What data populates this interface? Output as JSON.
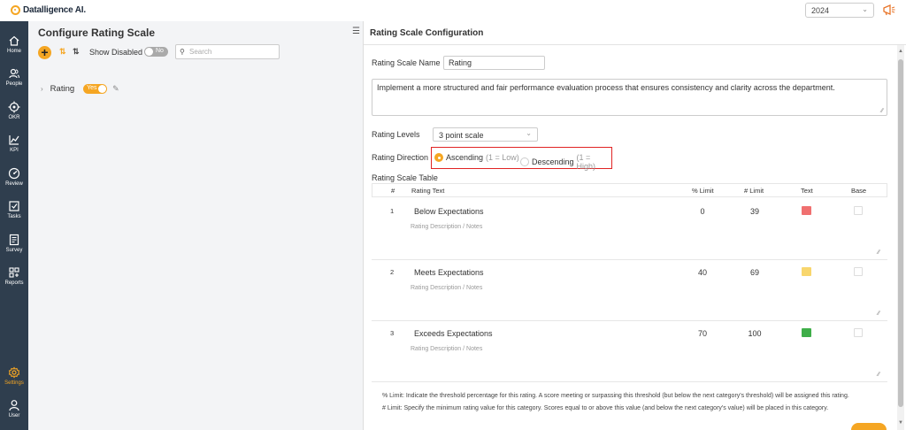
{
  "app": {
    "logo_text": "Datalligence AI."
  },
  "topbar": {
    "year_value": "2024"
  },
  "sidebar": {
    "items": [
      {
        "label": "Home",
        "icon": "home-icon"
      },
      {
        "label": "People",
        "icon": "people-icon"
      },
      {
        "label": "OKR",
        "icon": "target-icon"
      },
      {
        "label": "KPI",
        "icon": "chart-icon"
      },
      {
        "label": "Review",
        "icon": "gauge-icon"
      },
      {
        "label": "Tasks",
        "icon": "checkbox-icon"
      },
      {
        "label": "Survey",
        "icon": "survey-icon"
      },
      {
        "label": "Reports",
        "icon": "reports-icon"
      },
      {
        "label": "Settings",
        "icon": "gear-icon"
      },
      {
        "label": "User",
        "icon": "user-icon"
      }
    ],
    "active": "Settings",
    "accent_color": "#f5a623"
  },
  "main": {
    "title": "Configure Rating Scale",
    "show_disabled_label": "Show Disabled",
    "show_disabled_toggle": "No",
    "search_placeholder": "Search",
    "tree": {
      "label": "Rating",
      "toggle": "Yes"
    }
  },
  "panel": {
    "title": "Rating Scale Configuration",
    "name_label": "Rating Scale Name",
    "name_value": "Rating",
    "description": "Implement a more structured and fair performance evaluation process that ensures consistency and clarity across the department.",
    "levels_label": "Rating Levels",
    "levels_value": "3 point scale",
    "direction_label": "Rating Direction",
    "direction_options": [
      {
        "label": "Ascending",
        "hint": "(1 = Low)",
        "selected": true
      },
      {
        "label": "Descending",
        "hint": "(1 = High)",
        "selected": false
      }
    ],
    "table_title": "Rating Scale Table",
    "table_headers": {
      "num": "#",
      "text": "Rating Text",
      "pct": "% Limit",
      "lim": "# Limit",
      "color": "Text",
      "base": "Base"
    },
    "rows": [
      {
        "num": "1",
        "text": "Below Expectations",
        "pct": "0",
        "lim": "39",
        "color": "#f07070",
        "notes_placeholder": "Rating Description / Notes"
      },
      {
        "num": "2",
        "text": "Meets Expectations",
        "pct": "40",
        "lim": "69",
        "color": "#f8d66d",
        "notes_placeholder": "Rating Description / Notes"
      },
      {
        "num": "3",
        "text": "Exceeds Expectations",
        "pct": "70",
        "lim": "100",
        "color": "#3fae49",
        "notes_placeholder": "Rating Description / Notes"
      }
    ],
    "footnotes": [
      "% Limit: Indicate the threshold percentage for this rating. A score meeting or surpassing this threshold (but below the next category's threshold) will be assigned this rating.",
      "# Limit: Specify the minimum rating value for this category. Scores equal to or above this value (and below the next category's value) will be placed in this category."
    ]
  }
}
